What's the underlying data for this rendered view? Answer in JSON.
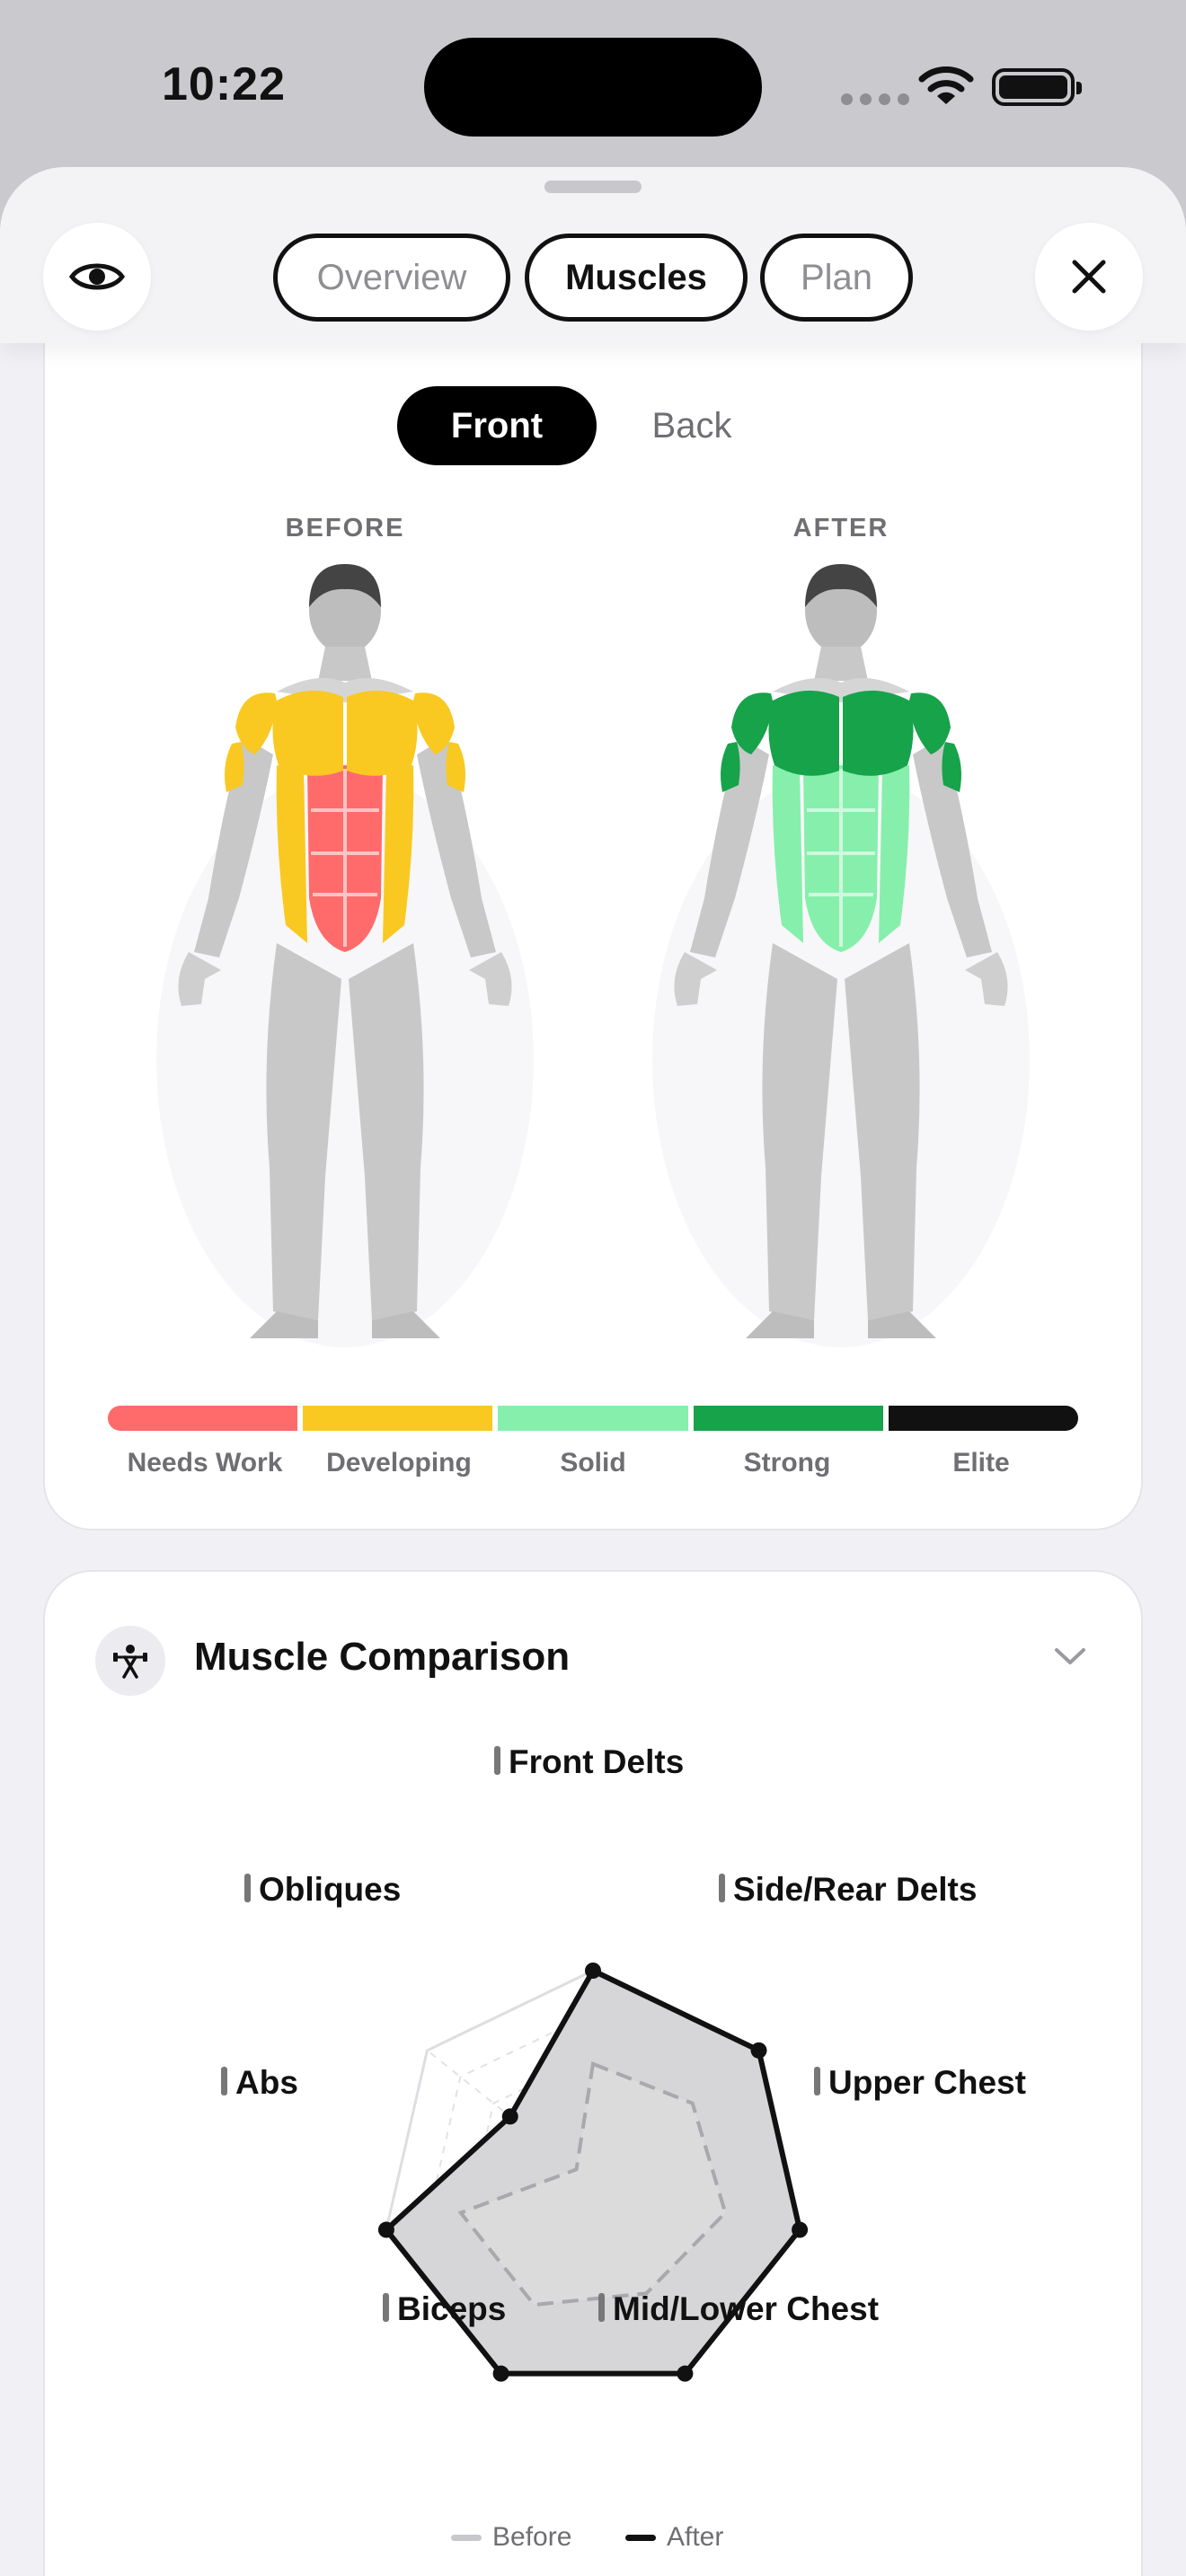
{
  "status_bar": {
    "time": "10:22"
  },
  "tabs": [
    {
      "label": "Overview",
      "active": false
    },
    {
      "label": "Muscles",
      "active": true
    },
    {
      "label": "Plan",
      "active": false
    }
  ],
  "view_toggle": {
    "front": "Front",
    "back": "Back",
    "selected": "Front"
  },
  "figures": {
    "before_label": "BEFORE",
    "after_label": "AFTER",
    "before_levels": {
      "delts": "Developing",
      "chest": "Developing",
      "abs": "Needs Work",
      "obliques": "Developing"
    },
    "after_levels": {
      "delts": "Strong",
      "chest": "Strong",
      "abs": "Solid",
      "obliques": "Solid"
    }
  },
  "legend": [
    {
      "label": "Needs Work",
      "color": "#ff6b6b"
    },
    {
      "label": "Developing",
      "color": "#f9c922"
    },
    {
      "label": "Solid",
      "color": "#86efac"
    },
    {
      "label": "Strong",
      "color": "#16a34a"
    },
    {
      "label": "Elite",
      "color": "#111111"
    }
  ],
  "comparison": {
    "title": "Muscle Comparison",
    "icon": "weightlifter-icon"
  },
  "chart_data": {
    "type": "radar",
    "axes": [
      "Front Delts",
      "Side/Rear Delts",
      "Upper Chest",
      "Mid/Lower Chest",
      "Biceps",
      "Abs",
      "Obliques"
    ],
    "rmax": 5,
    "grid_levels": 5,
    "series": [
      {
        "name": "Before",
        "values": [
          2.8,
          3.0,
          3.2,
          2.9,
          3.2,
          3.2,
          0.5
        ],
        "color": "#c7c7cc"
      },
      {
        "name": "After",
        "values": [
          5.0,
          5.0,
          5.0,
          5.0,
          5.0,
          5.0,
          2.5
        ],
        "color": "#111111"
      }
    ],
    "outer_ring": [
      5.0,
      5.0,
      5.0,
      5.0,
      5.0,
      5.0,
      5.0
    ]
  }
}
